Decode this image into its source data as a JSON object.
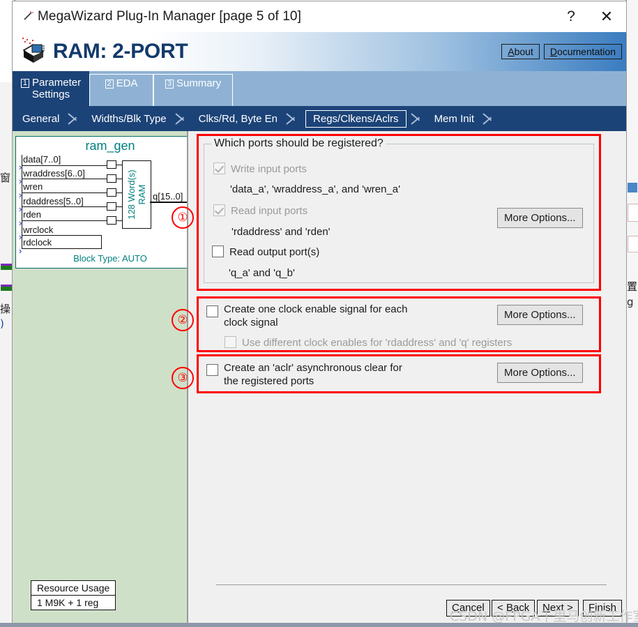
{
  "window": {
    "title": "MegaWizard Plug-In Manager [page 5 of 10]",
    "wand_icon": "wand-icon",
    "help_label": "?",
    "close_label": "✕"
  },
  "banner": {
    "title": "RAM: 2-PORT",
    "logo_icon": "chip-logo-icon",
    "about_label": "About",
    "about_mnemonic": "A",
    "documentation_label": "Documentation",
    "documentation_mnemonic": "D"
  },
  "main_tabs": [
    {
      "num": "1",
      "label": "Parameter\nSettings",
      "line1": "Parameter",
      "line2": "Settings",
      "active": true
    },
    {
      "num": "2",
      "label": "EDA",
      "active": false
    },
    {
      "num": "3",
      "label": "Summary",
      "active": false
    }
  ],
  "breadcrumbs": [
    {
      "label": "General",
      "selected": false
    },
    {
      "label": "Widths/Blk Type",
      "selected": false
    },
    {
      "label": "Clks/Rd, Byte En",
      "selected": false
    },
    {
      "label": "Regs/Clkens/Aclrs",
      "selected": true
    },
    {
      "label": "Mem Init",
      "selected": false
    }
  ],
  "symbol": {
    "name": "ram_gen",
    "block_type": "Block Type: AUTO",
    "core_label_line1": "128 Word(s)",
    "core_label_line2": "RAM",
    "inputs": [
      "data[7..0]",
      "wraddress[6..0]",
      "wren",
      "rdaddress[5..0]",
      "rden",
      "wrclock",
      "rdclock"
    ],
    "outputs": [
      "q[15..0]"
    ]
  },
  "resource": {
    "header": "Resource Usage",
    "value": "1 M9K + 1 reg"
  },
  "group1": {
    "marker": "①",
    "legend": "Which ports should be registered?",
    "items": [
      {
        "label": "Write input ports",
        "checked": true,
        "disabled": true,
        "detail": "'data_a', 'wraddress_a', and 'wren_a'"
      },
      {
        "label": "Read input ports",
        "checked": true,
        "disabled": true,
        "detail": "'rdaddress' and 'rden'"
      },
      {
        "label": "Read output port(s)",
        "checked": false,
        "disabled": false,
        "detail": "'q_a' and 'q_b'"
      }
    ],
    "more_options": "More Options..."
  },
  "group2": {
    "marker": "②",
    "label_line1": "Create one clock enable signal for each",
    "label_line2": "clock signal",
    "checked": false,
    "sub_label": "Use different clock enables for 'rdaddress' and 'q' registers",
    "sub_checked": false,
    "sub_disabled": true,
    "more_options": "More Options..."
  },
  "group3": {
    "marker": "③",
    "label_line1": "Create an 'aclr' asynchronous clear for",
    "label_line2": " the registered ports",
    "checked": false,
    "more_options": "More Options..."
  },
  "footer": {
    "cancel": "Cancel",
    "cancel_mnemonic": "C",
    "back": "< Back",
    "back_mnemonic": "B",
    "next": "Next >",
    "next_mnemonic": "N",
    "finish": "Finish",
    "finish_mnemonic": "F"
  },
  "watermark": "CSDN @FPGA千里马创新工作室",
  "colors": {
    "accent_dark_blue": "#1b4377",
    "tab_light_blue": "#8fb2d4",
    "highlight_red": "#ff0000",
    "diagram_teal": "#00807f",
    "left_pane_green": "#cfe0c8"
  },
  "background_peek": {
    "left_cjk_1": "窗",
    "left_cjk_2": "操",
    "left_cjk_3": ")",
    "right_cjk_1": "置",
    "right_text": "g"
  }
}
